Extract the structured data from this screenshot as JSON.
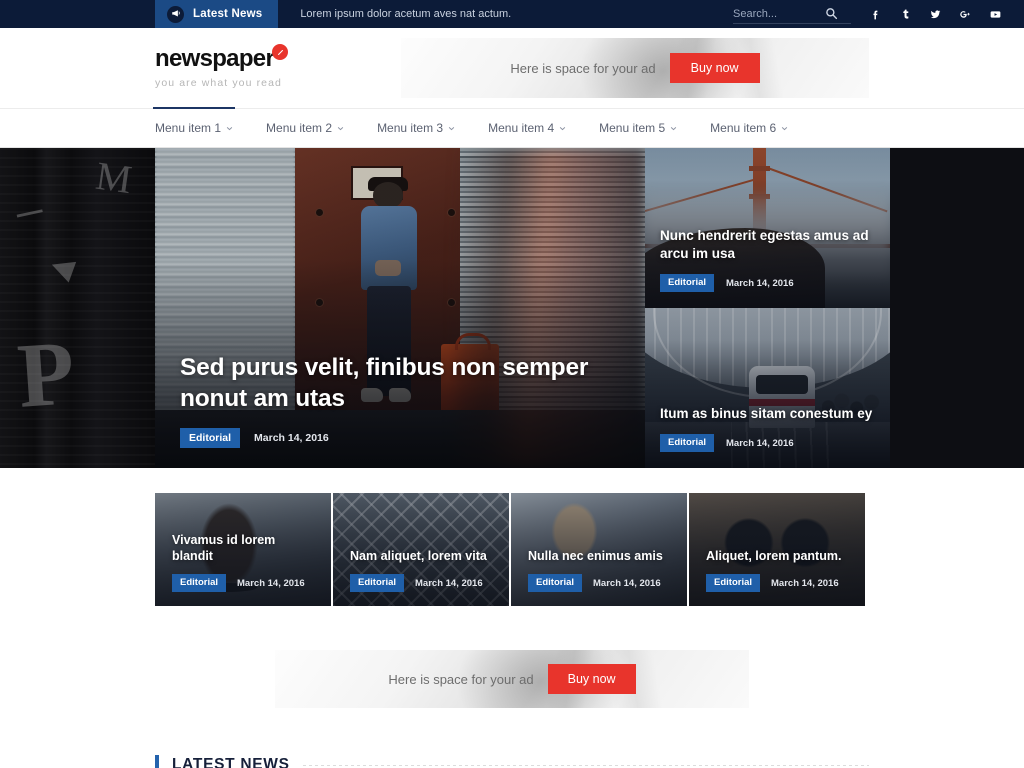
{
  "topbar": {
    "badge_label": "Latest News",
    "badge_icon": "megaphone-icon",
    "ticker_text": "Lorem ipsum dolor acetum aves nat actum.",
    "search_placeholder": "Search...",
    "search_value": "",
    "search_icon": "search-icon",
    "socials": [
      {
        "name": "facebook-icon",
        "label": "f"
      },
      {
        "name": "tumblr-icon",
        "label": "t"
      },
      {
        "name": "twitter-icon",
        "label": "y"
      },
      {
        "name": "google-plus-icon",
        "label": "g+"
      },
      {
        "name": "youtube-icon",
        "label": "yt"
      }
    ],
    "bg_color": "#0c1b38",
    "badge_bg_color": "#1b4a85"
  },
  "header": {
    "brand_name": "newspaper",
    "brand_mark": "red-circle-x-icon",
    "tagline": "you are what you read",
    "brand_accent_color": "#e8342c",
    "ad": {
      "text": "Here is space for your ad",
      "button_label": "Buy now",
      "button_color": "#e8342c"
    }
  },
  "nav": {
    "items": [
      {
        "label": "Menu item 1",
        "active": true
      },
      {
        "label": "Menu item 2",
        "active": false
      },
      {
        "label": "Menu item 3",
        "active": false
      },
      {
        "label": "Menu item 4",
        "active": false
      },
      {
        "label": "Menu item 5",
        "active": false
      },
      {
        "label": "Menu item 6",
        "active": false
      }
    ],
    "caret_icon": "chevron-down-icon",
    "active_indicator_color": "#1c3564"
  },
  "hero": {
    "featured": {
      "title": "Sed purus velit, finibus non semper nonut am utas",
      "category": "Editorial",
      "date": "March 14, 2016"
    },
    "side": [
      {
        "title": "Nunc hendrerit egestas amus ad arcu im usa",
        "category": "Editorial",
        "date": "March 14, 2016"
      },
      {
        "title": "Itum as binus sitam conestum ey",
        "category": "Editorial",
        "date": "March 14, 2016"
      }
    ],
    "category_badge_color": "#1f5fa9"
  },
  "cards": [
    {
      "title": "Vivamus id lorem blandit",
      "category": "Editorial",
      "date": "March 14, 2016"
    },
    {
      "title": "Nam aliquet, lorem vita",
      "category": "Editorial",
      "date": "March 14, 2016"
    },
    {
      "title": "Nulla nec enimus amis",
      "category": "Editorial",
      "date": "March 14, 2016"
    },
    {
      "title": "Aliquet, lorem pantum.",
      "category": "Editorial",
      "date": "March 14, 2016"
    }
  ],
  "bottom_ad": {
    "text": "Here is space for your ad",
    "button_label": "Buy now"
  },
  "latest_section": {
    "heading": "LATEST NEWS",
    "accent_color": "#2463ad"
  }
}
